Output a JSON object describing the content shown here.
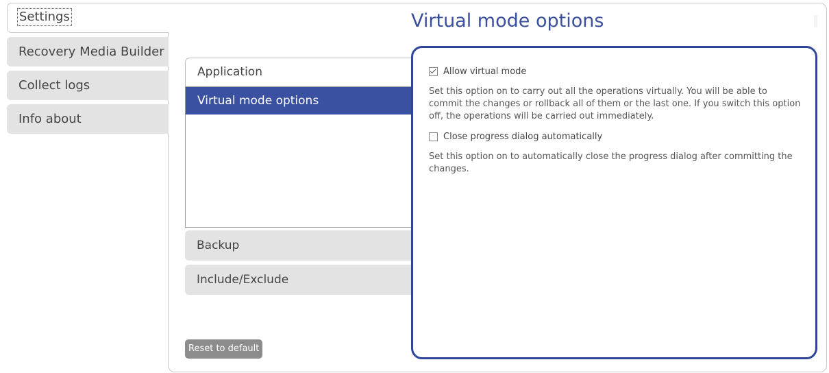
{
  "sidebar": {
    "tabs": [
      {
        "label": "Settings",
        "active": true
      },
      {
        "label": "Recovery Media Builder",
        "active": false
      },
      {
        "label": "Collect logs",
        "active": false
      },
      {
        "label": "Info about",
        "active": false
      }
    ]
  },
  "page": {
    "title": "Virtual mode options"
  },
  "categories": {
    "open_header": "Application",
    "items": [
      "Virtual mode options"
    ],
    "selected_item": "Virtual mode options",
    "closed_headers": [
      "Backup",
      "Include/Exclude"
    ]
  },
  "reset_button_label": "Reset to default",
  "options": {
    "allow_virtual_mode": {
      "label": "Allow virtual mode",
      "checked": true,
      "description": "Set this option on to carry out all the operations virtually. You will be able to commit the changes or rollback all of them or the last one. If you switch this option off, the operations will be carried out immediately."
    },
    "close_progress_dialog": {
      "label": "Close progress dialog automatically",
      "checked": false,
      "description": "Set this option on to automatically close the progress dialog after committing the changes."
    }
  },
  "colors": {
    "accent": "#2e4598",
    "title": "#3a4f9e",
    "selected_bg": "#3a50a0",
    "tab_bg": "#e3e3e3",
    "button_bg": "#8c8c8c"
  }
}
